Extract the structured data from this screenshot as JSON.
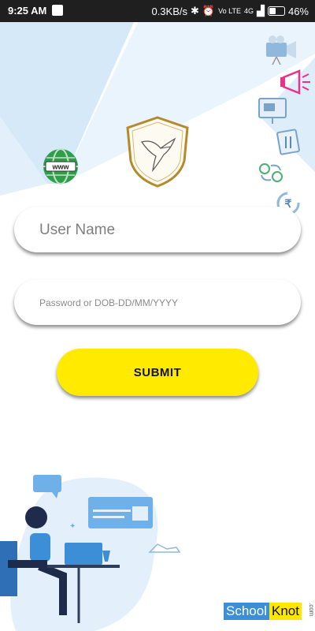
{
  "status_bar": {
    "time": "9:25 AM",
    "network_speed": "0.3KB/s",
    "network_type": "4G",
    "carrier_badge": "Vo LTE",
    "battery": "46%"
  },
  "login": {
    "username_placeholder": "User Name",
    "password_placeholder": "Password or DOB-DD/MM/YYYY",
    "submit_label": "SUBMIT"
  },
  "globe_label": "www",
  "brand": {
    "part1": "School",
    "part2": "Knot",
    "suffix": ".com"
  },
  "colors": {
    "submit": "#ffea00",
    "ray": "#cfe5f8",
    "illustration_blue": "#3c8fd6"
  }
}
